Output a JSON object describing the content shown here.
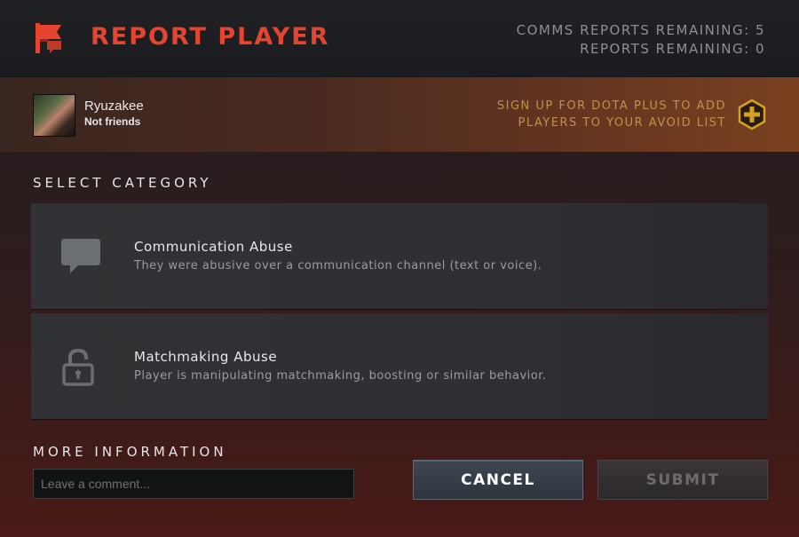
{
  "header": {
    "title": "REPORT PLAYER",
    "comms_reports": "COMMS REPORTS REMAINING: 5",
    "reports": "REPORTS REMAINING: 0"
  },
  "player": {
    "name": "Ryuzakee",
    "status": "Not friends"
  },
  "promo": {
    "line1": "SIGN UP FOR DOTA PLUS TO ADD",
    "line2": "PLAYERS TO YOUR AVOID LIST"
  },
  "category": {
    "label": "SELECT CATEGORY",
    "options": [
      {
        "title": "Communication Abuse",
        "description": "They were abusive over a communication channel (text or voice).",
        "icon": "speech-bubble-icon"
      },
      {
        "title": "Matchmaking Abuse",
        "description": "Player is manipulating matchmaking, boosting or similar behavior.",
        "icon": "padlock-icon"
      }
    ]
  },
  "more_info": {
    "label": "MORE INFORMATION",
    "placeholder": "Leave a comment..."
  },
  "buttons": {
    "cancel": "CANCEL",
    "submit": "SUBMIT"
  },
  "colors": {
    "title_red": "#e5452f",
    "promo_gold": "#c2904a",
    "plus_gold": "#d4a020"
  }
}
